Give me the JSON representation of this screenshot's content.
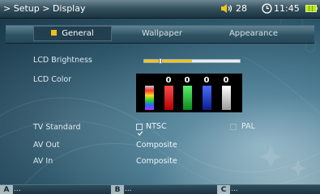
{
  "status": {
    "breadcrumb": "> Setup > Display",
    "volume": "28",
    "clock": "11:45"
  },
  "tabs": [
    {
      "label": "General",
      "selected": true
    },
    {
      "label": "Wallpaper",
      "selected": false
    },
    {
      "label": "Appearance",
      "selected": false
    }
  ],
  "settings": {
    "lcd_brightness": {
      "label": "LCD Brightness",
      "level_fraction": 0.5
    },
    "lcd_color": {
      "label": "LCD Color",
      "channels": [
        {
          "name": "spectrum",
          "value": ""
        },
        {
          "name": "red",
          "value": "0",
          "color": "#e21b1b"
        },
        {
          "name": "green",
          "value": "0",
          "color": "#1fc63b"
        },
        {
          "name": "blue",
          "value": "0",
          "color": "#1f3fd6"
        },
        {
          "name": "white",
          "value": "0",
          "color": "#f2f2f2"
        }
      ]
    },
    "tv_standard": {
      "label": "TV Standard",
      "options": [
        "NTSC",
        "PAL"
      ],
      "selected": "NTSC"
    },
    "av_out": {
      "label": "AV Out",
      "value": "Composite"
    },
    "av_in": {
      "label": "AV In",
      "value": "Composite"
    }
  },
  "softkeys": [
    {
      "key": "A",
      "text": "..."
    },
    {
      "key": "B",
      "text": "..."
    },
    {
      "key": "C",
      "text": "..."
    }
  ],
  "colors": {
    "accent": "#f1bd1e",
    "background": "#2c5468",
    "battery": "#b8e61a"
  }
}
